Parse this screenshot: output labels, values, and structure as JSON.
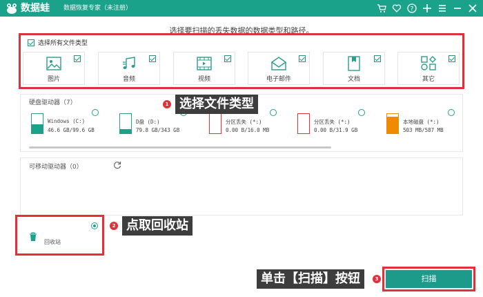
{
  "app": {
    "name": "数据蛙",
    "subtitle": "数据恢复专家（未注册）"
  },
  "toolbar_icons": [
    "cart-icon",
    "heart-icon",
    "help-icon",
    "plus-icon",
    "menu-icon",
    "minimize-icon",
    "close-icon"
  ],
  "instruction": "选择要扫描的丢失数据的数据类型和路径。",
  "file_types": {
    "select_all_label": "选择所有文件类型",
    "items": [
      {
        "label": "图片",
        "icon": "image-icon",
        "checked": true
      },
      {
        "label": "音频",
        "icon": "music-icon",
        "checked": true
      },
      {
        "label": "视频",
        "icon": "video-icon",
        "checked": true
      },
      {
        "label": "电子邮件",
        "icon": "email-icon",
        "checked": true
      },
      {
        "label": "文档",
        "icon": "document-icon",
        "checked": true
      },
      {
        "label": "其它",
        "icon": "other-icon",
        "checked": true
      }
    ]
  },
  "hard_drives": {
    "title": "硬盘驱动器（7）",
    "items": [
      {
        "name": "Windows (C:)",
        "size": "46.6 GB/99.6 GB",
        "fill": 0.47
      },
      {
        "name": "D盘 (D:)",
        "size": "79.8 GB/343 GB",
        "fill": 0.23
      },
      {
        "name": "分区丢失 (*:)",
        "size": "0.00  B/16.0 MB",
        "fill": 0
      },
      {
        "name": "分区丢失 (*:)",
        "size": "0.00  B/31.9 GB",
        "fill": 0
      },
      {
        "name": "本地磁盘 (*:)",
        "size": "503 MB/587 MB",
        "fill": 0.86
      }
    ]
  },
  "removable": {
    "title": "可移动驱动器（0）"
  },
  "recycle_bin": {
    "label": "回收站",
    "selected": true
  },
  "callouts": [
    {
      "number": "1",
      "text": "选择文件类型"
    },
    {
      "number": "2",
      "text": "点取回收站"
    },
    {
      "number": "3",
      "text": "单击【扫描】按钮"
    }
  ],
  "scan_button": "扫描",
  "colors": {
    "brand": "#1aa38a",
    "highlight": "#e0313a",
    "callout_bg": "#3d3d3d",
    "drive_orange": "#f08a00"
  }
}
